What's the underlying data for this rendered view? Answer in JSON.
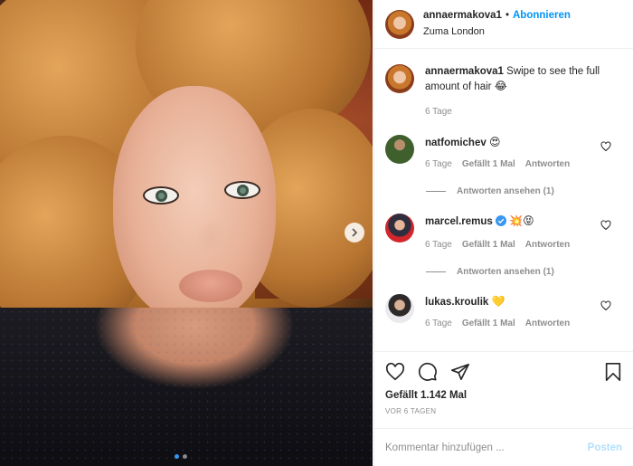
{
  "post": {
    "username": "annaermakova1",
    "separator": "•",
    "follow_label": "Abonnieren",
    "location": "Zuma London"
  },
  "caption": {
    "username": "annaermakova1",
    "text": "Swipe to see the full amount of hair",
    "emoji": "😂",
    "age": "6 Tage"
  },
  "comments": [
    {
      "username": "natfomichev",
      "text": "😍",
      "age": "6 Tage",
      "likes": "Gefällt 1 Mal",
      "reply": "Antworten",
      "view_replies": "Antworten ansehen (1)"
    },
    {
      "username": "marcel.remus",
      "verified": true,
      "text": "💥😝",
      "age": "6 Tage",
      "likes": "Gefällt 1 Mal",
      "reply": "Antworten",
      "view_replies": "Antworten ansehen (1)"
    },
    {
      "username": "lukas.kroulik",
      "text": "💛",
      "age": "6 Tage",
      "likes": "Gefällt 1 Mal",
      "reply": "Antworten"
    }
  ],
  "footer": {
    "likes": "Gefällt 1.142 Mal",
    "time_ago": "VOR 6 TAGEN"
  },
  "add_comment": {
    "placeholder": "Kommentar hinzufügen ...",
    "post_label": "Posten"
  },
  "icons": {
    "like": "heart-icon",
    "comment": "comment-icon",
    "share": "paper-plane-icon",
    "save": "bookmark-icon",
    "next": "chevron-right-icon",
    "verified": "verified-badge-icon"
  },
  "colors": {
    "accent": "#0095f6",
    "muted": "#8e8e8e",
    "post_disabled": "#b2dffc",
    "verified": "#3897f0"
  },
  "carousel": {
    "total": 2,
    "current": 1
  }
}
